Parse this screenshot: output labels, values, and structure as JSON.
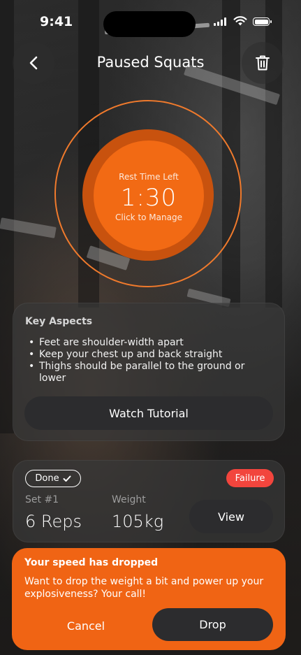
{
  "status_bar": {
    "time": "9:41"
  },
  "header": {
    "title": "Paused Squats",
    "back_icon": "chevron-left-icon",
    "delete_icon": "trash-icon"
  },
  "timer": {
    "label": "Rest Time Left",
    "value": "1:30",
    "hint": "Click to Manage"
  },
  "key_aspects": {
    "title": "Key Aspects",
    "items": [
      "Feet are shoulder-width apart",
      "Keep your chest up and back straight",
      "Thighs should be parallel to the ground or lower"
    ],
    "button_label": "Watch Tutorial"
  },
  "set": {
    "done_label": "Done",
    "done_icon": "checkmark-icon",
    "failure_label": "Failure",
    "set_label": "Set #1",
    "weight_label": "Weight",
    "reps": "6 Reps",
    "weight": "105kg",
    "view_label": "View"
  },
  "alert": {
    "title": "Your speed has dropped",
    "body": "Want to drop the weight a bit and power up your explosiveness? Your call!",
    "cancel_label": "Cancel",
    "drop_label": "Drop"
  },
  "colors": {
    "accent": "#f06414",
    "timer_outer": "#c8520e",
    "failure": "#f2453d",
    "button_dark": "#2c2c2e"
  }
}
